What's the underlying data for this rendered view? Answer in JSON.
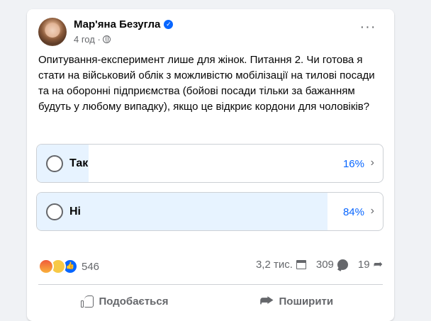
{
  "post": {
    "author": "Мар'яна Безугла",
    "verified_icon": "verified-badge-icon",
    "time": "4 год ·",
    "privacy_icon": "globe-icon",
    "more_label": "···",
    "text": "Опитування-експеримент лише для жінок. Питання 2. Чи готова я стати на військовий облік з можливістю мобілізації на тилові посади та на оборонні підприємства (бойові посади тільки за бажанням будуть у любому випадку), якщо це відкриє кордони для чоловіків?"
  },
  "poll": {
    "options": [
      {
        "label": "Так",
        "percent_text": "16%",
        "percent": 16
      },
      {
        "label": "Ні",
        "percent_text": "84%",
        "percent": 84
      }
    ],
    "fill_color": "#e7f3ff",
    "percent_color": "#0866ff"
  },
  "stats": {
    "reaction_icons": [
      "angry-reaction-icon",
      "laugh-reaction-icon",
      "like-reaction-icon"
    ],
    "reactions_count": "546",
    "views": "3,2 тис.",
    "comments": "309",
    "shares": "19"
  },
  "actions": {
    "like_label": "Подобається",
    "share_label": "Поширити"
  }
}
